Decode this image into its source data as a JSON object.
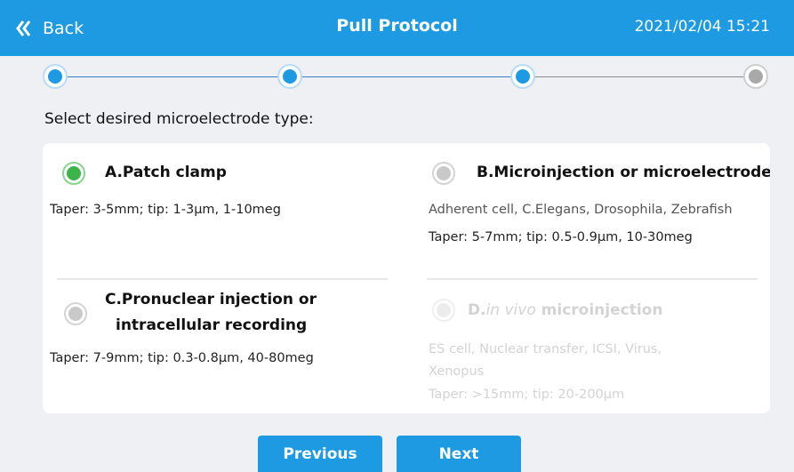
{
  "header": {
    "back_label": "Back",
    "title": "Pull Protocol",
    "datetime": "2021/02/04  15:21"
  },
  "stepper": {
    "total_steps": 4,
    "current_step": 3
  },
  "prompt": "Select desired microelectrode type:",
  "options": [
    {
      "title": "A.Patch clamp",
      "lines": [
        "Taper: 3-5mm; tip: 1-3µm, 1-10meg"
      ],
      "state": "selected"
    },
    {
      "title": "B.Microinjection or microelectrode",
      "lines": [
        "Adherent cell, C.Elegans, Drosophila, Zebrafish",
        "Taper: 5-7mm; tip: 0.5-0.9µm, 10-30meg"
      ],
      "state": "unselected"
    },
    {
      "title_line1": "C.Pronuclear injection or",
      "title_line2": "intracellular recording",
      "lines": [
        "Taper: 7-9mm; tip: 0.3-0.8µm, 40-80meg"
      ],
      "state": "unselected"
    },
    {
      "title_prefix": "D.",
      "title_italic": "in vivo",
      "title_suffix": " microinjection",
      "lines": [
        "ES cell, Nuclear transfer, ICSI, Virus,",
        "Xenopus",
        "Taper: >15mm; tip: 20-200µm"
      ],
      "state": "disabled"
    }
  ],
  "buttons": {
    "previous": "Previous",
    "next": "Next"
  },
  "colors": {
    "accent": "#1e9ae3",
    "selected_radio": "#3cb44a",
    "inactive_step": "#a9a9a9",
    "background": "#eef0f3"
  },
  "icons": {
    "back": "double-chevron-left-icon"
  }
}
